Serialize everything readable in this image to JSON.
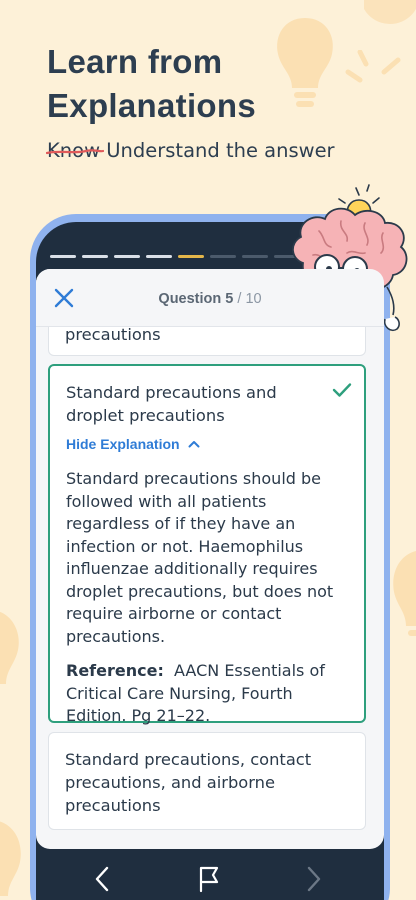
{
  "headline": {
    "line1": "Learn from",
    "line2": "Explanations"
  },
  "subline": {
    "struck": "Know",
    "rest": "Understand the answer"
  },
  "quiz": {
    "question_label": "Question 5",
    "question_total": "/ 10",
    "partial_option": "precautions",
    "correct_option": {
      "line1": "Standard precautions and",
      "line2": "droplet precautions",
      "toggle": "Hide Explanation",
      "explanation": "Standard precautions should be followed with all patients regardless of if they have an infection or not. Haemophilus influenzae additionally requires droplet precautions, but does not require airborne or contact precautions.",
      "reference_label": "Reference:",
      "reference_text": "AACN Essentials of Critical Care Nursing, Fourth Edition. Pg 21–22."
    },
    "next_option": {
      "line1": "Standard precautions, contact",
      "line2": "precautions, and airborne",
      "line3": "precautions"
    },
    "progress": {
      "completed": 4,
      "current": 5,
      "visible_segments": 9
    }
  },
  "colors": {
    "background": "#fdf1d8",
    "correct": "#2e9f7d",
    "link": "#2f7cd6",
    "progress_current": "#e4b64a"
  },
  "icons": [
    "close-icon",
    "check-icon",
    "chevron-up-icon",
    "chevron-left-icon",
    "flag-icon",
    "chevron-right-icon",
    "lightbulb-icon",
    "brain-mascot"
  ]
}
